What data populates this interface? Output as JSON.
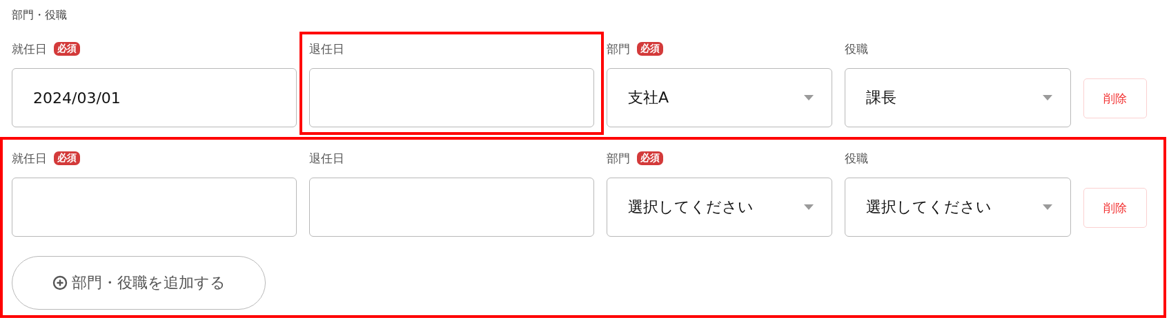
{
  "section_title": "部門・役職",
  "rows": [
    {
      "highlighted": false,
      "fields": [
        {
          "kind": "date",
          "label": "就任日",
          "badge": "必須",
          "highlighted": false,
          "value": "2024/03/01"
        },
        {
          "kind": "date",
          "label": "退任日",
          "highlighted": true
        },
        {
          "kind": "select",
          "label": "部門",
          "badge": "必須",
          "highlighted": false,
          "value": "支社A"
        },
        {
          "kind": "select",
          "label": "役職",
          "highlighted": false,
          "value": "課長"
        }
      ],
      "delete_label": "削除"
    },
    {
      "highlighted": true,
      "fields": [
        {
          "kind": "date",
          "label": "就任日",
          "badge": "必須",
          "highlighted": false
        },
        {
          "kind": "date",
          "label": "退任日",
          "highlighted": false
        },
        {
          "kind": "select",
          "label": "部門",
          "badge": "必須",
          "highlighted": false,
          "placeholder": "選択してください"
        },
        {
          "kind": "select",
          "label": "役職",
          "highlighted": false,
          "placeholder": "選択してください"
        }
      ],
      "delete_label": "削除"
    }
  ],
  "add_button": {
    "label": "部門・役職を追加する"
  }
}
